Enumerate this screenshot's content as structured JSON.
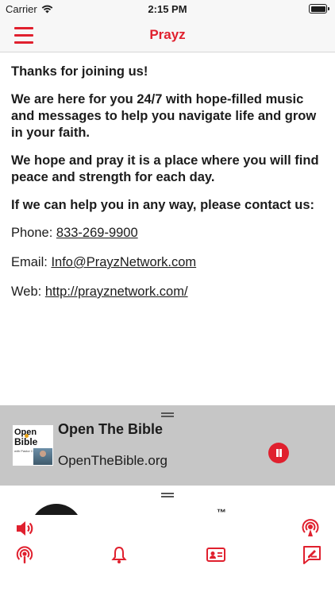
{
  "status_bar": {
    "carrier": "Carrier",
    "time": "2:15 PM"
  },
  "header": {
    "title": "Prayz",
    "menu_icon": "hamburger-menu-icon"
  },
  "content": {
    "greeting": "Thanks for joining us!",
    "paragraph_1": "We are here for you 24/7 with hope-filled music and messages to help you navigate life and grow in your faith.",
    "paragraph_2": "We hope and pray it is a place where you will find peace and strength for each day.",
    "paragraph_3": "If we can help you in any way, please contact us:",
    "phone_label": "Phone:",
    "phone_value": "833-269-9900",
    "email_label": "Email:",
    "email_value": "Info@PrayzNetwork.com",
    "web_label": "Web:",
    "web_value": "http://prayznetwork.com/"
  },
  "now_playing": {
    "title": "Open The Bible",
    "subtitle": "OpenTheBible.org",
    "art_line_1": "Open",
    "art_line_2": "Bible",
    "art_tagline": "with Pastor Colin Smith",
    "state": "playing"
  },
  "bottom_panel": {
    "trademark": "™",
    "icons": [
      "speaker-icon",
      "broadcast-icon",
      "podcast-icon",
      "bell-icon",
      "contact-card-icon",
      "edit-message-icon"
    ]
  },
  "colors": {
    "accent": "#e0202e",
    "bar_background": "#f7f7f7",
    "player_background": "#c6c6c6",
    "text": "#1c1c1c"
  }
}
